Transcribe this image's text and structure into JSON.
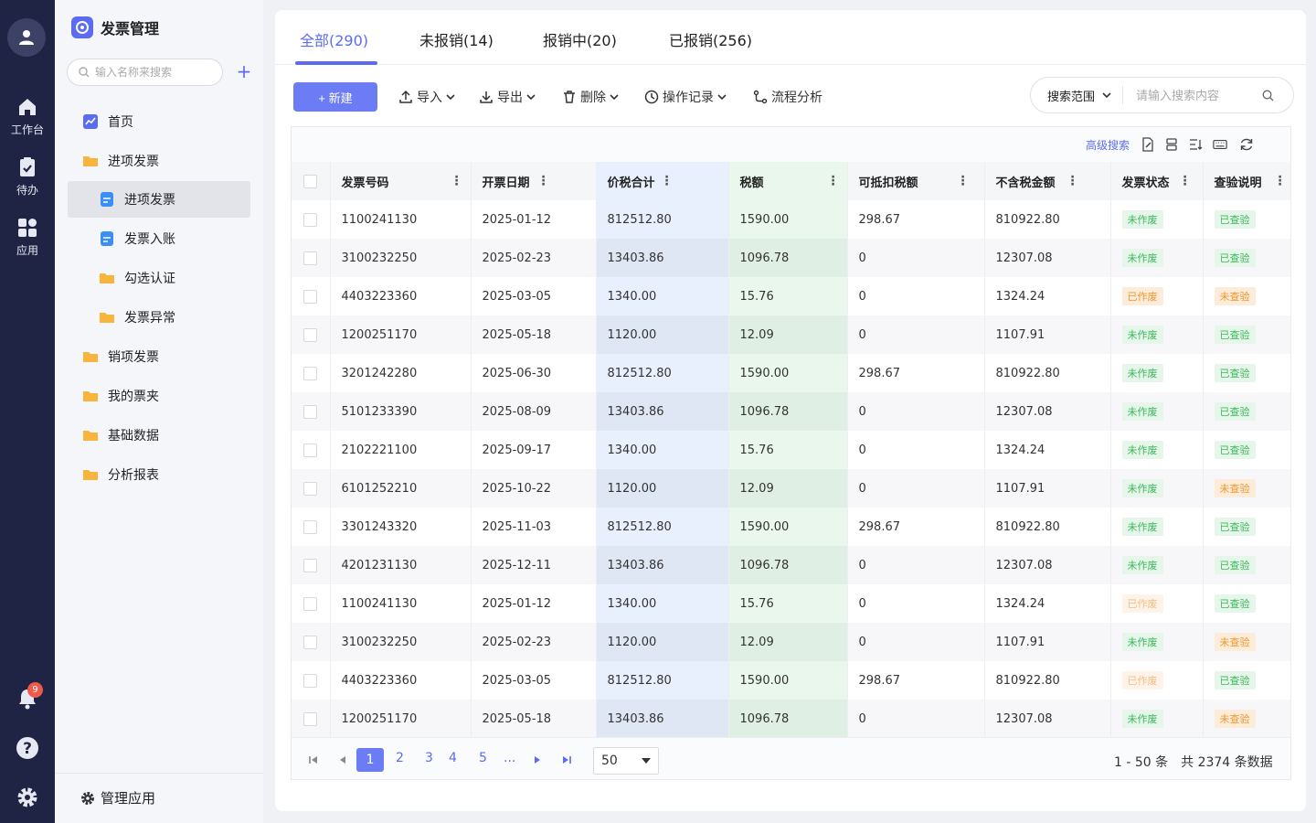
{
  "rail": {
    "items": [
      {
        "label": "工作台",
        "icon": "home-icon"
      },
      {
        "label": "待办",
        "icon": "clipboard-check-icon"
      },
      {
        "label": "应用",
        "icon": "apps-grid-icon"
      }
    ],
    "notification_count": "9"
  },
  "sidebar": {
    "title": "发票管理",
    "search_placeholder": "输入名称来搜索",
    "items": [
      {
        "label": "首页"
      },
      {
        "label": "进项发票"
      },
      {
        "label": "进项发票"
      },
      {
        "label": "发票入账"
      },
      {
        "label": "勾选认证"
      },
      {
        "label": "发票异常"
      },
      {
        "label": "销项发票"
      },
      {
        "label": "我的票夹"
      },
      {
        "label": "基础数据"
      },
      {
        "label": "分析报表"
      }
    ],
    "manage_label": "管理应用"
  },
  "tabs": [
    {
      "label": "全部(290)"
    },
    {
      "label": "未报销(14)"
    },
    {
      "label": "报销中(20)"
    },
    {
      "label": "已报销(256)"
    }
  ],
  "toolbar": {
    "new_label": "+ 新建",
    "import_label": "导入",
    "export_label": "导出",
    "delete_label": "删除",
    "log_label": "操作记录",
    "flow_label": "流程分析",
    "scope_label": "搜索范围",
    "search_placeholder": "请输入搜索内容"
  },
  "table": {
    "advanced_search": "高级搜索",
    "columns": [
      "发票号码",
      "开票日期",
      "价税合计",
      "税额",
      "可抵扣税额",
      "不含税金额",
      "发票状态",
      "查验说明"
    ],
    "rows": [
      {
        "no": "1100241130",
        "date": "2025-01-12",
        "sum": "812512.80",
        "tax": "1590.00",
        "deduct": "298.67",
        "net": "810922.80",
        "status": "未作废",
        "check": "已查验"
      },
      {
        "no": "3100232250",
        "date": "2025-02-23",
        "sum": "13403.86",
        "tax": "1096.78",
        "deduct": "0",
        "net": "12307.08",
        "status": "未作废",
        "check": "已查验"
      },
      {
        "no": "4403223360",
        "date": "2025-03-05",
        "sum": "1340.00",
        "tax": "15.76",
        "deduct": "0",
        "net": "1324.24",
        "status": "已作废",
        "check": "未查验"
      },
      {
        "no": "1200251170",
        "date": "2025-05-18",
        "sum": "1120.00",
        "tax": "12.09",
        "deduct": "0",
        "net": "1107.91",
        "status": "未作废",
        "check": "已查验"
      },
      {
        "no": "3201242280",
        "date": "2025-06-30",
        "sum": "812512.80",
        "tax": "1590.00",
        "deduct": "298.67",
        "net": "810922.80",
        "status": "未作废",
        "check": "已查验"
      },
      {
        "no": "5101233390",
        "date": "2025-08-09",
        "sum": "13403.86",
        "tax": "1096.78",
        "deduct": "0",
        "net": "12307.08",
        "status": "未作废",
        "check": "已查验"
      },
      {
        "no": "2102221100",
        "date": "2025-09-17",
        "sum": "1340.00",
        "tax": "15.76",
        "deduct": "0",
        "net": "1324.24",
        "status": "未作废",
        "check": "已查验"
      },
      {
        "no": "6101252210",
        "date": "2025-10-22",
        "sum": "1120.00",
        "tax": "12.09",
        "deduct": "0",
        "net": "1107.91",
        "status": "未作废",
        "check": "未查验"
      },
      {
        "no": "3301243320",
        "date": "2025-11-03",
        "sum": "812512.80",
        "tax": "1590.00",
        "deduct": "298.67",
        "net": "810922.80",
        "status": "未作废",
        "check": "已查验"
      },
      {
        "no": "4201231130",
        "date": "2025-12-11",
        "sum": "13403.86",
        "tax": "1096.78",
        "deduct": "0",
        "net": "12307.08",
        "status": "未作废",
        "check": "已查验"
      },
      {
        "no": "1100241130",
        "date": "2025-01-12",
        "sum": "1340.00",
        "tax": "15.76",
        "deduct": "0",
        "net": "1324.24",
        "status": "已作废",
        "check": "已查验"
      },
      {
        "no": "3100232250",
        "date": "2025-02-23",
        "sum": "1120.00",
        "tax": "12.09",
        "deduct": "0",
        "net": "1107.91",
        "status": "未作废",
        "check": "未查验"
      },
      {
        "no": "4403223360",
        "date": "2025-03-05",
        "sum": "812512.80",
        "tax": "1590.00",
        "deduct": "298.67",
        "net": "810922.80",
        "status": "已作废",
        "check": "已查验"
      },
      {
        "no": "1200251170",
        "date": "2025-05-18",
        "sum": "13403.86",
        "tax": "1096.78",
        "deduct": "0",
        "net": "12307.08",
        "status": "未作废",
        "check": "未查验"
      }
    ]
  },
  "pagination": {
    "pages": [
      "1",
      "2",
      "3",
      "4",
      "5",
      "..."
    ],
    "page_size": "50",
    "range": "1 - 50 条",
    "total": "共 2374 条数据"
  },
  "colors": {
    "accent": "#5b6cf0",
    "rail_bg": "#1f2444",
    "ok_green": "#3bb85a",
    "warn_orange": "#f0972c"
  }
}
